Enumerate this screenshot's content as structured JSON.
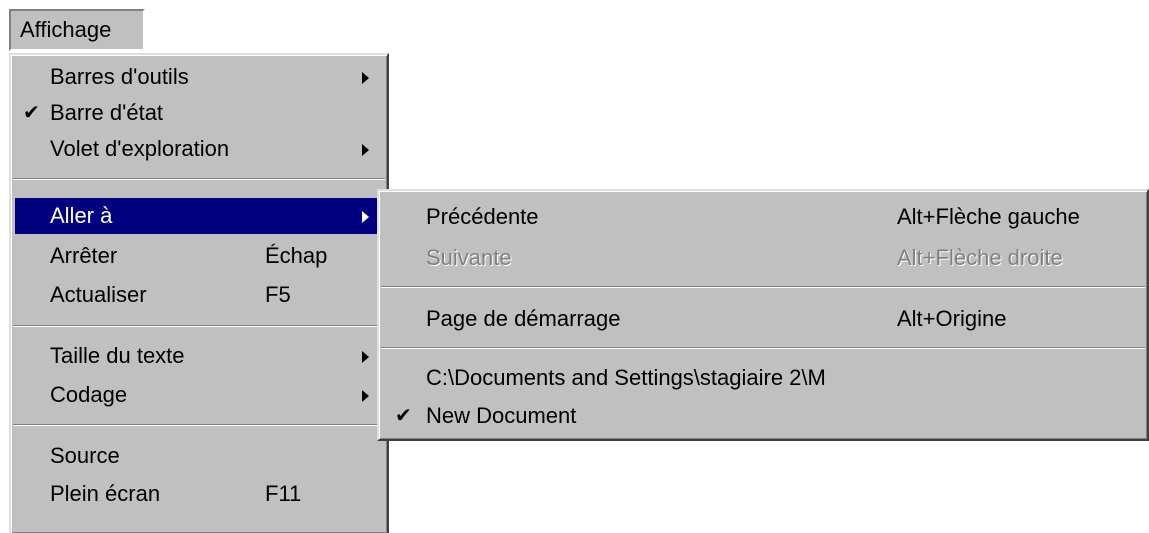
{
  "menubar": {
    "title": "Affichage"
  },
  "main_menu": {
    "items": [
      {
        "label": "Barres d'outils",
        "shortcut": "",
        "checked": false,
        "submenu": true
      },
      {
        "label": "Barre d'état",
        "shortcut": "",
        "checked": true,
        "submenu": false
      },
      {
        "label": "Volet d'exploration",
        "shortcut": "",
        "checked": false,
        "submenu": true
      },
      {
        "label": "Aller à",
        "shortcut": "",
        "checked": false,
        "submenu": true,
        "highlighted": true
      },
      {
        "label": "Arrêter",
        "shortcut": "Échap",
        "checked": false,
        "submenu": false
      },
      {
        "label": "Actualiser",
        "shortcut": "F5",
        "checked": false,
        "submenu": false
      },
      {
        "label": "Taille du texte",
        "shortcut": "",
        "checked": false,
        "submenu": true
      },
      {
        "label": "Codage",
        "shortcut": "",
        "checked": false,
        "submenu": true
      },
      {
        "label": "Source",
        "shortcut": "",
        "checked": false,
        "submenu": false
      },
      {
        "label": "Plein écran",
        "shortcut": "F11",
        "checked": false,
        "submenu": false
      }
    ]
  },
  "submenu": {
    "items": [
      {
        "label": "Précédente",
        "shortcut": "Alt+Flèche gauche",
        "disabled": false,
        "checked": false
      },
      {
        "label": "Suivante",
        "shortcut": "Alt+Flèche droite",
        "disabled": true,
        "checked": false
      },
      {
        "label": "Page de démarrage",
        "shortcut": "Alt+Origine",
        "disabled": false,
        "checked": false
      },
      {
        "label": "C:\\Documents and Settings\\stagiaire 2\\M",
        "shortcut": "",
        "disabled": false,
        "checked": false
      },
      {
        "label": "New Document",
        "shortcut": "",
        "disabled": false,
        "checked": true
      }
    ]
  },
  "glyphs": {
    "check": "✔"
  },
  "colors": {
    "menu_bg": "#c0c0c0",
    "highlight_bg": "#000080",
    "highlight_text": "#ffffff",
    "disabled_text": "#808080"
  }
}
